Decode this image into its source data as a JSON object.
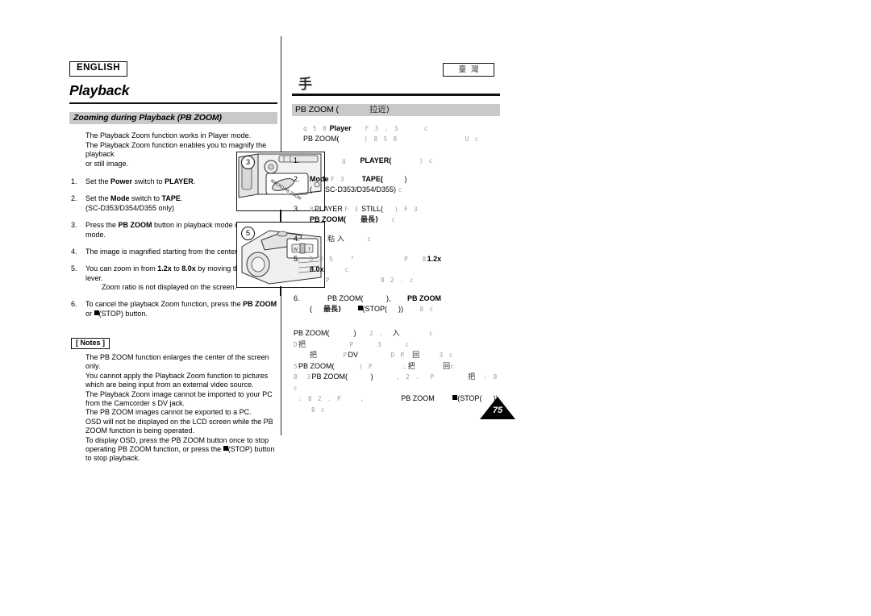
{
  "left": {
    "lang_badge": "ENGLISH",
    "chapter_title": "Playback",
    "section_title": "Zooming during Playback (PB ZOOM)",
    "intro": [
      "The Playback Zoom function works in Player mode.",
      "The Playback Zoom function enables you to magnify the playback",
      "or still image."
    ],
    "steps": [
      {
        "num": "1.",
        "parts": [
          {
            "t": "Set the ",
            "b": false
          },
          {
            "t": "Power",
            "b": true
          },
          {
            "t": " switch to ",
            "b": false
          },
          {
            "t": "PLAYER",
            "b": true
          },
          {
            "t": ".",
            "b": false
          }
        ],
        "sub": ""
      },
      {
        "num": "2.",
        "parts": [
          {
            "t": "Set the ",
            "b": false
          },
          {
            "t": "Mode",
            "b": true
          },
          {
            "t": " switch to ",
            "b": false
          },
          {
            "t": "TAPE",
            "b": true
          },
          {
            "t": ".",
            "b": false
          }
        ],
        "sub": "(SC-D353/D354/D355 only)"
      },
      {
        "num": "3.",
        "parts": [
          {
            "t": "Press the ",
            "b": false
          },
          {
            "t": "PB ZOOM",
            "b": true
          },
          {
            "t": " button in playback mode or in still mode.",
            "b": false
          }
        ],
        "sub": ""
      },
      {
        "num": "4.",
        "parts": [
          {
            "t": "The image is magnified starting from the center of image.",
            "b": false
          }
        ],
        "sub": ""
      },
      {
        "num": "5.",
        "parts": [
          {
            "t": "You can zoom in from ",
            "b": false
          },
          {
            "t": "1.2x",
            "b": true
          },
          {
            "t": " to ",
            "b": false
          },
          {
            "t": "8.0x",
            "b": true
          },
          {
            "t": " by moving the Zoom lever.",
            "b": false
          }
        ],
        "sub": "Zoom ratio is not displayed on the screen."
      },
      {
        "num": "6.",
        "parts": [
          {
            "t": "To cancel the playback Zoom function, press the ",
            "b": false
          },
          {
            "t": "PB ZOOM",
            "b": true
          },
          {
            "t": " or ",
            "b": false
          }
        ],
        "sub": ""
      }
    ],
    "step6_tail": "(STOP) button.",
    "notes_head": "[ Notes ]",
    "notes": [
      "The PB ZOOM function enlarges the center of the screen only.",
      "You cannot apply the Playback Zoom function to pictures which are being input from an external video source.",
      "The Playback Zoom image cannot be imported to your PC from the Camcorder s DV jack.",
      "The PB ZOOM images cannot be exported to a PC.",
      "OSD will not be displayed on the LCD screen while the PB ZOOM function is being operated."
    ],
    "note_last_a": "To display OSD, press the PB ZOOM button once to stop operating PB ZOOM function, or press the ",
    "note_last_b": "(STOP) button to stop playback."
  },
  "right": {
    "tw_badge": "臺灣",
    "chapter_title": "手",
    "section_title_a": "PB ZOOM (",
    "section_title_b": "拉近)",
    "intro_l1_ghost": "q 5 8",
    "intro_l1_a": "Player",
    "intro_l1_ghost2": "F 3 , 3",
    "intro_l1_ghost3": "c",
    "intro_l2_a": "PB ZOOM(",
    "intro_l2_ghost": ") 8 5 8",
    "intro_l2_ghost2": "U   c",
    "steps": [
      {
        "num": "1.",
        "g1": "g",
        "bold": "PLAYER(",
        "g2": ") c"
      },
      {
        "num": "2.",
        "b1": "Mode",
        "g1": "F 3",
        "bold": "TAPE(",
        "g2": ")",
        "sub_a": "(",
        "sub_b": "SC-D353/D354/D355)",
        "sub_g": "c"
      },
      {
        "num": "3.",
        "g1": "8",
        "t1": "PLAYER",
        "g2": "F 3",
        "t2": "STILL(",
        "g3": ") F 3",
        "bold": "PB ZOOM(",
        "cjk": "最長)",
        "g4": "c"
      },
      {
        "num": "4.",
        "cjk": "粘 入",
        "g1": "c"
      },
      {
        "num": "5.",
        "g1": "D 8 5",
        "g2": "°",
        "g3": "P",
        "g4": "8",
        "b1": "1.2x",
        "b2": "8.0x",
        "g5": "c",
        "sub_g1": "P",
        "sub_g2": "8 2 .  c"
      },
      {
        "num": "6.",
        "t1": "PB ZOOM(",
        "g1": "),",
        "b1": "PB ZOOM",
        "sub_a": "(",
        "sub_cjk": "最長)",
        "sub_b": "(STOP(",
        "sub_c": "))",
        "sub_g": "8  c"
      }
    ],
    "notes": {
      "l1_a": "PB ZOOM(",
      "l1_g1": ")",
      "l1_g2": "2 .",
      "l1_cjk": "入",
      "l1_g3": "c",
      "l2_g1": "D",
      "l2_cjk": "把",
      "l2_g2": "P",
      "l2_g3": "3",
      "l2_g4": "c",
      "l3_cjk": "把",
      "l3_g1": "P",
      "l3_t": "DV",
      "l3_g2": "D P",
      "l3_cjk2": "回",
      "l3_g3": "3 c",
      "l4_g1": "5",
      "l4_t": "PB ZOOM(",
      "l4_g2": ") P",
      "l4_g3": ",",
      "l4_cjk": "把",
      "l4_cjk2": "回",
      "l4_g4": "c",
      "l5_g1": "8",
      "l5_g2": "3",
      "l5_t": "PB ZOOM(",
      "l5_g3": ")",
      "l5_g4": ", 2 .",
      "l5_g5": "P",
      "l5_cjk": "把",
      "l5_g6": ": 8 c",
      "l6_g1": ":  8 2 .  P",
      "l6_g2": ",",
      "l6_t": "PB ZOOM",
      "l6_b": "(STOP(",
      "l6_g3": "))",
      "l7_g": "8  c"
    }
  },
  "illustrations": {
    "callout_3": "3",
    "callout_5": "5",
    "button_label": "MACRO/PB ZOOM",
    "lever_w": "W",
    "lever_t": "T"
  },
  "page_number": "75"
}
